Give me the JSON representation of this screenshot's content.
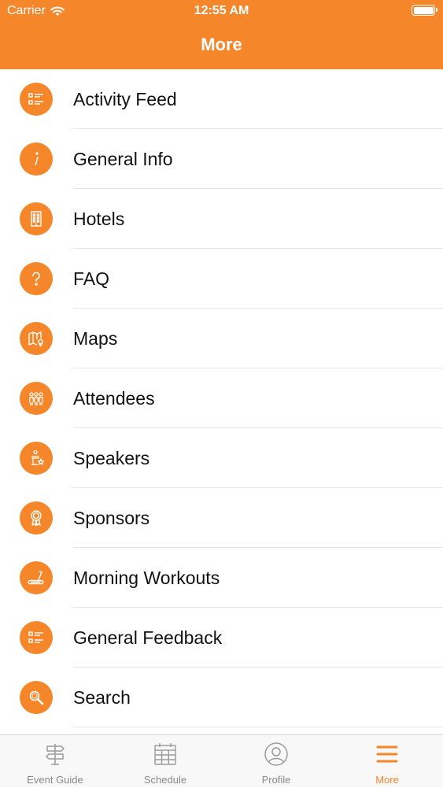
{
  "status_bar": {
    "carrier": "Carrier",
    "time": "12:55 AM"
  },
  "nav": {
    "title": "More"
  },
  "accent_color": "#F5862A",
  "menu": {
    "items": [
      {
        "label": "Activity Feed",
        "icon": "list-icon"
      },
      {
        "label": "General Info",
        "icon": "info-icon"
      },
      {
        "label": "Hotels",
        "icon": "building-icon"
      },
      {
        "label": "FAQ",
        "icon": "question-icon"
      },
      {
        "label": "Maps",
        "icon": "map-icon"
      },
      {
        "label": "Attendees",
        "icon": "people-icon"
      },
      {
        "label": "Speakers",
        "icon": "podium-icon"
      },
      {
        "label": "Sponsors",
        "icon": "ribbon-icon"
      },
      {
        "label": "Morning Workouts",
        "icon": "treadmill-icon"
      },
      {
        "label": "General Feedback",
        "icon": "list-icon"
      },
      {
        "label": "Search",
        "icon": "search-icon"
      }
    ]
  },
  "tabs": [
    {
      "label": "Event Guide",
      "icon": "signpost-icon",
      "active": false
    },
    {
      "label": "Schedule",
      "icon": "calendar-icon",
      "active": false
    },
    {
      "label": "Profile",
      "icon": "profile-icon",
      "active": false
    },
    {
      "label": "More",
      "icon": "menu-icon",
      "active": true
    }
  ]
}
